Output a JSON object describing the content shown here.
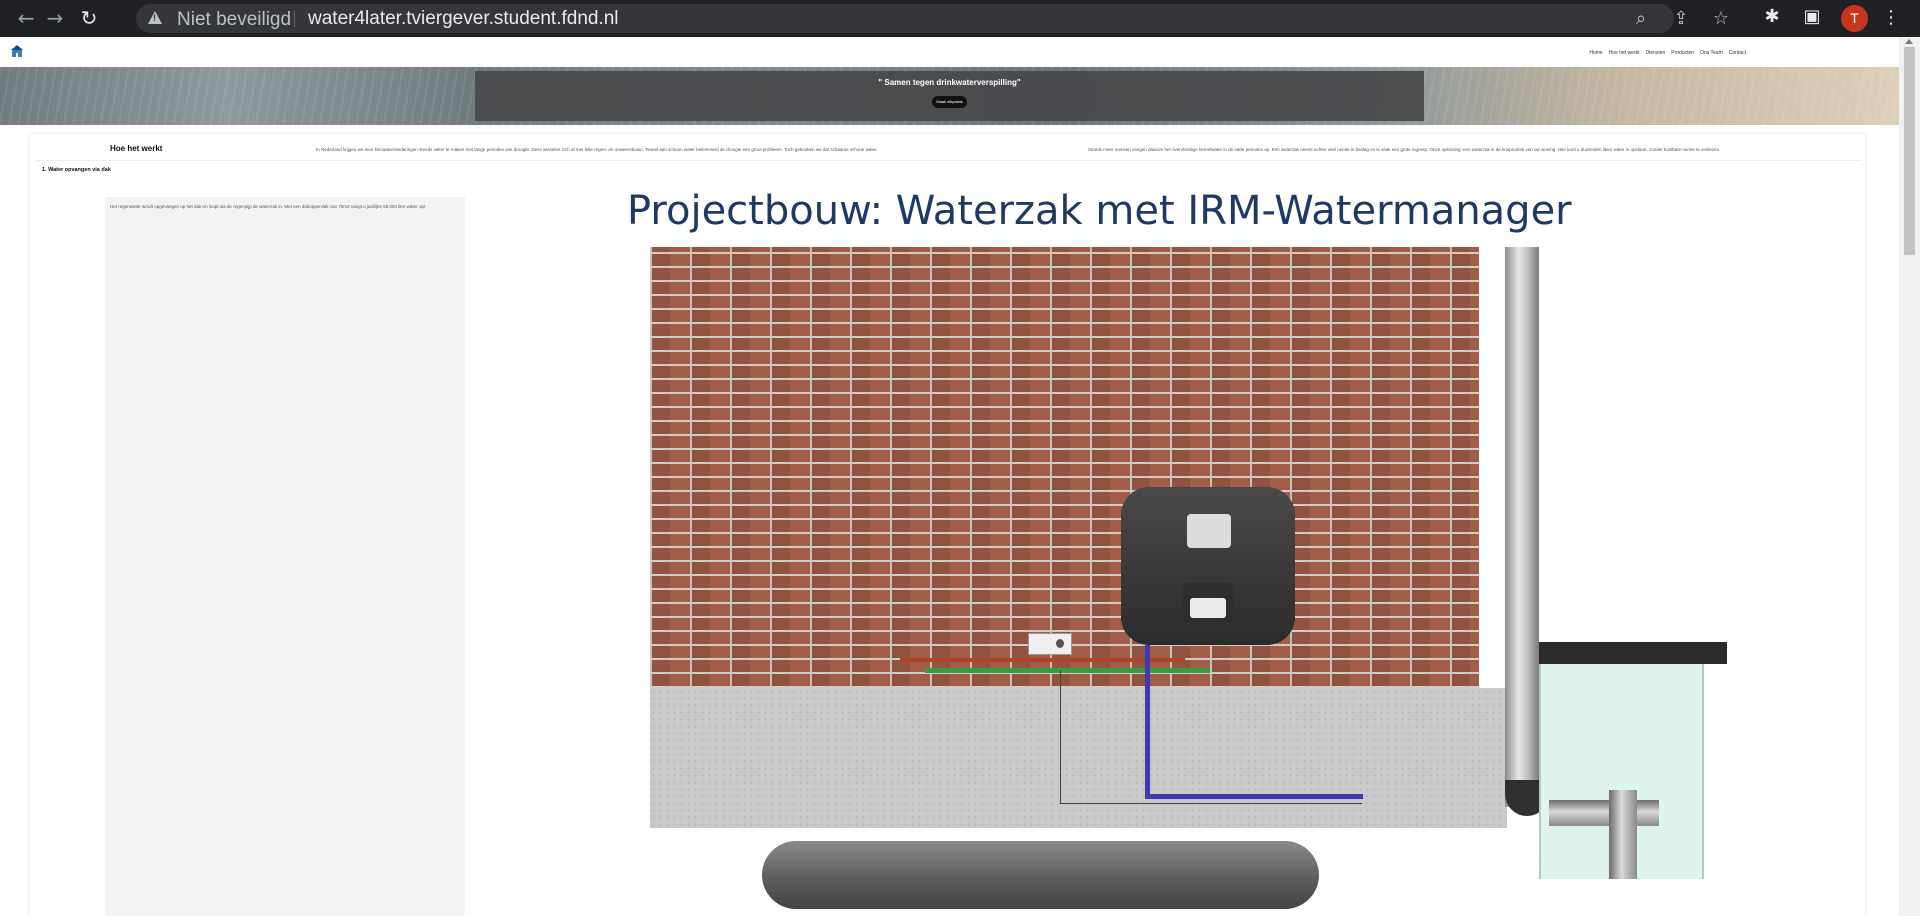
{
  "browser": {
    "security_label": "Niet beveiligd",
    "url": "water4later.tviergever.student.fdnd.nl",
    "profile_initial": "T",
    "icons": [
      "back-icon",
      "forward-icon",
      "reload-icon",
      "warning-icon",
      "zoom-icon",
      "share-icon",
      "star-icon",
      "extensions-icon",
      "side-panel-icon",
      "menu-icon"
    ]
  },
  "site": {
    "nav_links": [
      "Home",
      "Hoe het werkt",
      "Diensten",
      "Producten",
      "Ons Team",
      "Contact"
    ],
    "hero_title": "\" Samen tegen drinkwaterverspilling\"",
    "hero_button": "Maak afspraak",
    "section_title": "Hoe het werkt",
    "intro_left": "In Nederland krijgen we door klimaatveranderingen steeds vaker te maken met lange periodes van droogte. Deze wisselen zich af met felle regen- en onweersbuien. Teveel aan schoon water belemmerd de droogte een groot probleem. Toch gebruiken we dat schaarse schone water.",
    "intro_right": "Steeds meer mensen vangen daarom het overvloedige hemelwater in de natte periodes op. Een waterzak neemt echter veel ruimte in beslag en is vaak een grote ingreep. Onze oplossing: een waterzak in de kruipruimte van uw woning. Hier kunt u duizenden liters water in opslaan, zonder kostbare ruimte te verliezen.",
    "step_title": "1. Water opvangen via dak",
    "step_text": "Het regenwater wordt opgevangen op het dak en loopt via de regenpijp de waterzak in. Met een dakoppervlak van 75m2 vangt u jaarlijks 55.000 liter water op!",
    "diagram_title": "Projectbouw: Waterzak met IRM-Watermanager"
  },
  "colors": {
    "chrome_bg": "#202124",
    "omnibox_bg": "#35363a",
    "avatar": "#c5361f",
    "diagram_title": "#1f3864"
  }
}
